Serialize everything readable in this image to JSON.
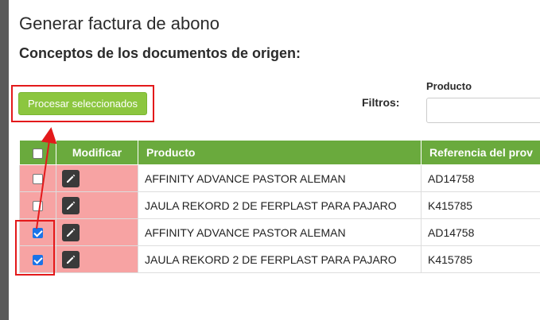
{
  "dialog": {
    "title": "Generar factura de abono",
    "subtitle": "Conceptos de los documentos de origen:"
  },
  "toolbar": {
    "process_label": "Procesar seleccionados",
    "filters_label": "Filtros:",
    "producto_filter_label": "Producto",
    "producto_filter_value": ""
  },
  "table": {
    "headers": {
      "select_all": "",
      "modificar": "Modificar",
      "producto": "Producto",
      "referencia": "Referencia del prov"
    },
    "rows": [
      {
        "checked": false,
        "producto": "AFFINITY ADVANCE PASTOR ALEMAN",
        "referencia": "AD14758"
      },
      {
        "checked": false,
        "producto": "JAULA REKORD 2 DE FERPLAST PARA PAJARO",
        "referencia": "K415785"
      },
      {
        "checked": true,
        "producto": "AFFINITY ADVANCE PASTOR ALEMAN",
        "referencia": "AD14758"
      },
      {
        "checked": true,
        "producto": "JAULA REKORD 2 DE FERPLAST PARA PAJARO",
        "referencia": "K415785"
      }
    ]
  },
  "colors": {
    "accent_green": "#8cc63f",
    "header_green": "#6aaa3d",
    "row_highlight": "#f7a3a3",
    "annotation_red": "#e3191b",
    "checkbox_blue": "#1a73e8"
  },
  "icons": {
    "edit": "pencil-icon",
    "checkbox": "checkbox-icon"
  }
}
